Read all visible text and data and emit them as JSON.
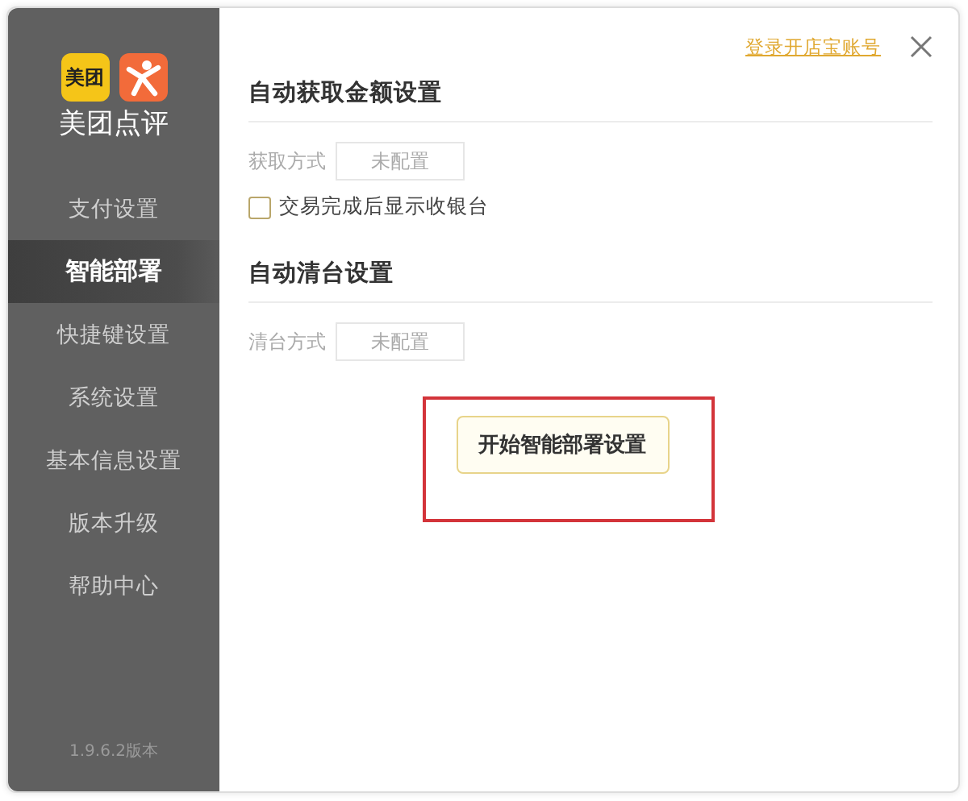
{
  "logo": {
    "badge": "美团",
    "name": "美团点评"
  },
  "sidebar": {
    "items": [
      {
        "label": "支付设置",
        "selected": false
      },
      {
        "label": "智能部署",
        "selected": true
      },
      {
        "label": "快捷键设置",
        "selected": false
      },
      {
        "label": "系统设置",
        "selected": false
      },
      {
        "label": "基本信息设置",
        "selected": false
      },
      {
        "label": "版本升级",
        "selected": false
      },
      {
        "label": "帮助中心",
        "selected": false
      }
    ],
    "version": "1.9.6.2版本"
  },
  "header": {
    "link": "登录开店宝账号"
  },
  "sections": [
    {
      "title": "自动获取金额设置",
      "fields": [
        {
          "label": "获取方式",
          "value": "未配置"
        }
      ],
      "checkboxes": [
        {
          "label": "交易完成后显示收银台",
          "checked": false
        }
      ]
    },
    {
      "title": "自动清台设置",
      "fields": [
        {
          "label": "清台方式",
          "value": "未配置"
        }
      ]
    }
  ],
  "action": {
    "label": "开始智能部署设置",
    "highlighted": true
  }
}
